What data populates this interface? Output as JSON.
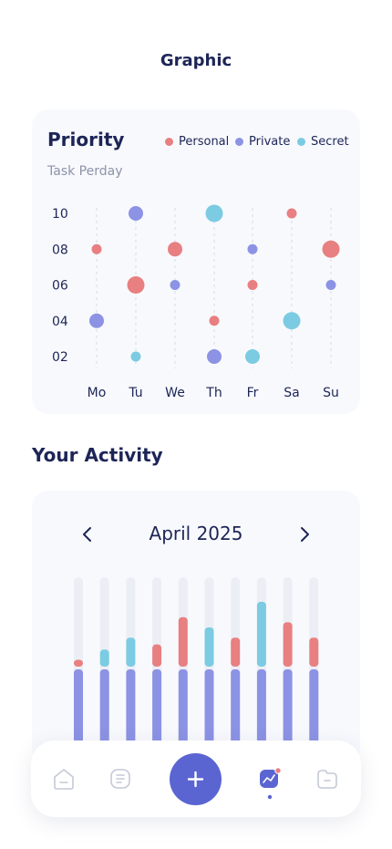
{
  "header": {
    "title": "Graphic"
  },
  "priority": {
    "title": "Priority",
    "subtitle": "Task Perday",
    "legend": [
      {
        "label": "Personal",
        "color": "#e87f80"
      },
      {
        "label": "Private",
        "color": "#8c92e4"
      },
      {
        "label": "Secret",
        "color": "#7bcbe2"
      }
    ]
  },
  "chart_data": {
    "type": "scatter",
    "x_categories": [
      "Mo",
      "Tu",
      "We",
      "Th",
      "Fr",
      "Sa",
      "Su"
    ],
    "y_ticks": [
      "10",
      "08",
      "06",
      "04",
      "02"
    ],
    "ylim": [
      2,
      10
    ],
    "series": [
      {
        "name": "Personal",
        "color": "#e87f80",
        "points": [
          {
            "x": "Mo",
            "y": 8,
            "size": "small"
          },
          {
            "x": "Tu",
            "y": 6,
            "size": "large"
          },
          {
            "x": "We",
            "y": 8,
            "size": "medium"
          },
          {
            "x": "Th",
            "y": 4,
            "size": "small"
          },
          {
            "x": "Fr",
            "y": 6,
            "size": "small"
          },
          {
            "x": "Sa",
            "y": 10,
            "size": "small"
          },
          {
            "x": "Su",
            "y": 8,
            "size": "large"
          }
        ]
      },
      {
        "name": "Private",
        "color": "#8c92e4",
        "points": [
          {
            "x": "Mo",
            "y": 4,
            "size": "medium"
          },
          {
            "x": "Tu",
            "y": 10,
            "size": "medium"
          },
          {
            "x": "We",
            "y": 6,
            "size": "small"
          },
          {
            "x": "Th",
            "y": 2,
            "size": "medium"
          },
          {
            "x": "Fr",
            "y": 8,
            "size": "small"
          },
          {
            "x": "Su",
            "y": 6,
            "size": "small"
          }
        ]
      },
      {
        "name": "Secret",
        "color": "#7bcbe2",
        "points": [
          {
            "x": "Tu",
            "y": 2,
            "size": "small"
          },
          {
            "x": "Th",
            "y": 10,
            "size": "large"
          },
          {
            "x": "Fr",
            "y": 2,
            "size": "medium"
          },
          {
            "x": "Sa",
            "y": 4,
            "size": "large"
          }
        ]
      }
    ]
  },
  "activity": {
    "title": "Your Activity",
    "month": "April 2025",
    "prev_icon": "chevron-left-icon",
    "next_icon": "chevron-right-icon",
    "bars": [
      {
        "base": 0.46,
        "top": 0.04,
        "top_color": "#e87f80"
      },
      {
        "base": 0.46,
        "top": 0.1,
        "top_color": "#7bcbe2"
      },
      {
        "base": 0.46,
        "top": 0.17,
        "top_color": "#7bcbe2"
      },
      {
        "base": 0.46,
        "top": 0.13,
        "top_color": "#e87f80"
      },
      {
        "base": 0.46,
        "top": 0.29,
        "top_color": "#e87f80"
      },
      {
        "base": 0.46,
        "top": 0.23,
        "top_color": "#7bcbe2"
      },
      {
        "base": 0.46,
        "top": 0.17,
        "top_color": "#e87f80"
      },
      {
        "base": 0.46,
        "top": 0.38,
        "top_color": "#7bcbe2"
      },
      {
        "base": 0.46,
        "top": 0.26,
        "top_color": "#e87f80"
      },
      {
        "base": 0.46,
        "top": 0.17,
        "top_color": "#e87f80"
      }
    ],
    "base_color": "#8c92e4"
  },
  "nav": {
    "items": [
      "home-icon",
      "notes-icon",
      "add-icon",
      "stats-icon",
      "folder-icon"
    ],
    "active": "stats-icon",
    "accent": "#5a65d2"
  }
}
